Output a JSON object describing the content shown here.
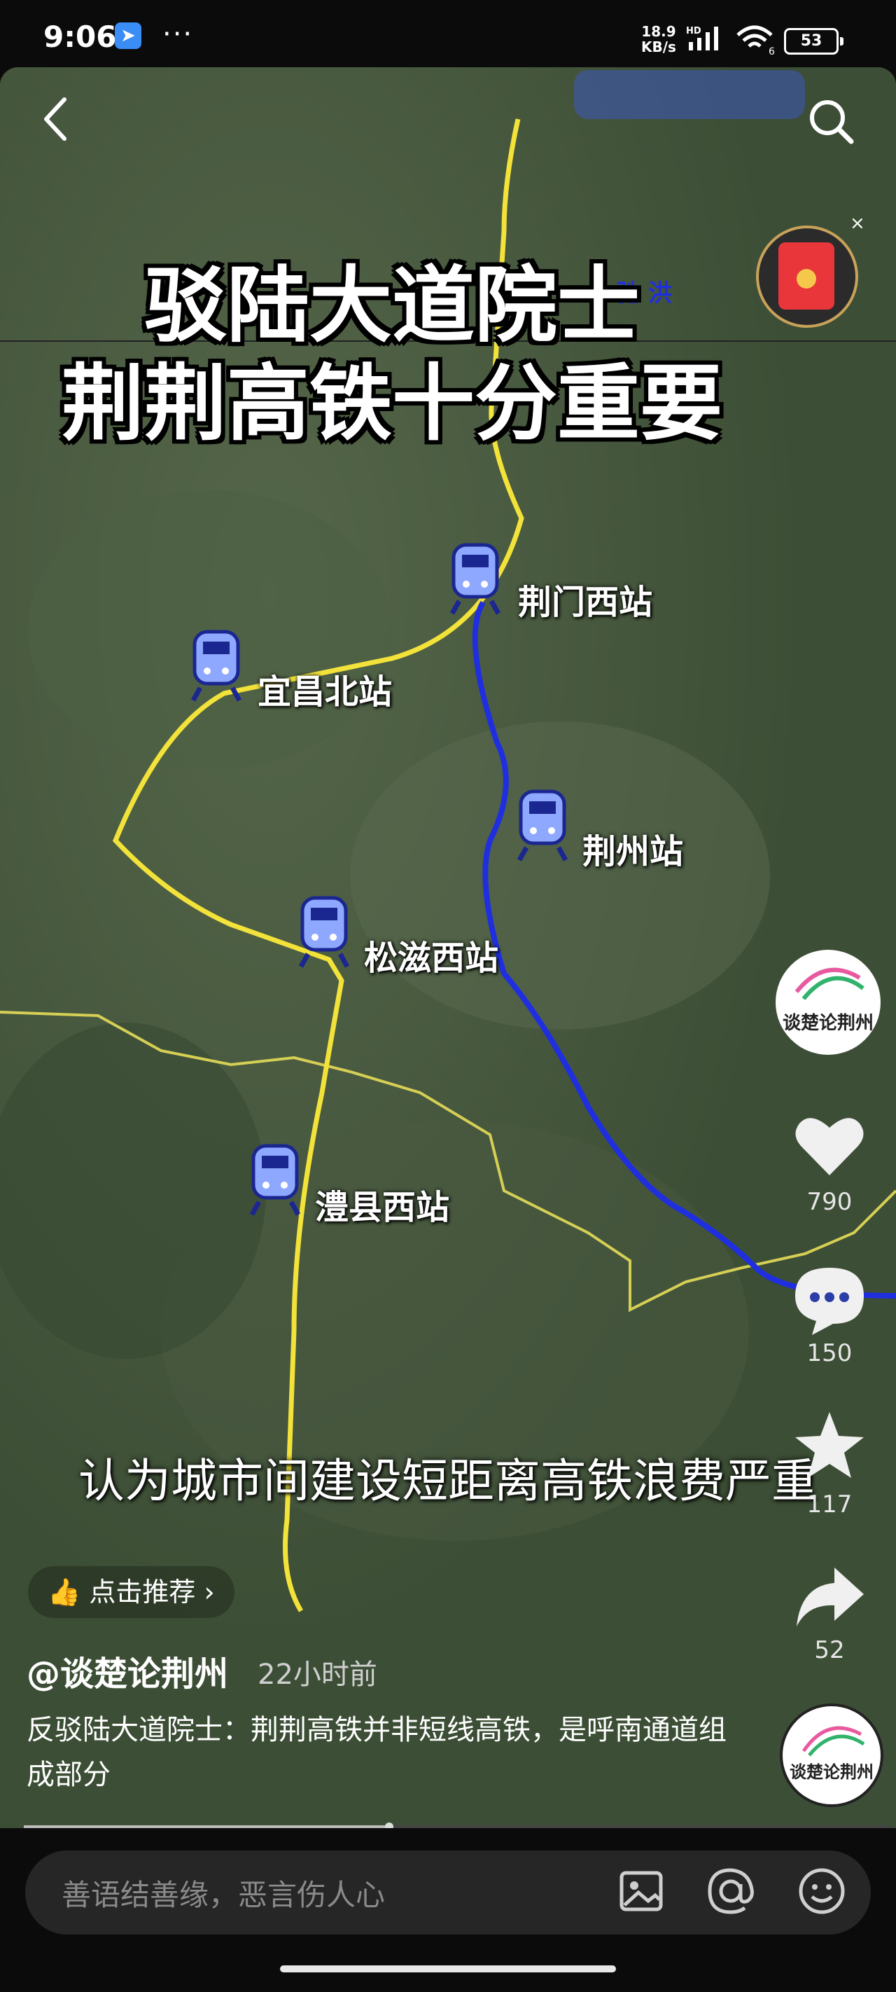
{
  "status_bar": {
    "time": "9:06",
    "net_speed_value": "18.9",
    "net_speed_unit": "KB/s",
    "signal_label": "HD",
    "wifi_label": "6",
    "battery": "53"
  },
  "video": {
    "title_line1": "驳陆大道院士",
    "title_line2": "荆荆高铁十分重要",
    "overlay_small_text": "驰 洪",
    "stations": [
      "荆门西站",
      "宜昌北站",
      "荆州站",
      "松滋西站",
      "澧县西站"
    ],
    "subtitle": "认为城市间建设短距离高铁浪费严重",
    "route_colors": {
      "yellow": "#f2e23a",
      "blue": "#1f2fe0",
      "border": "#d6cf55"
    }
  },
  "rail": {
    "avatar_text": "谈楚论荆州",
    "likes": "790",
    "comments": "150",
    "favorites": "117",
    "shares": "52"
  },
  "post": {
    "recommend_label": "点击推荐",
    "author": "@谈楚论荆州",
    "time_ago": "22小时前",
    "description": "反驳陆大道院士：荆荆高铁并非短线高铁，是呼南通道组成部分",
    "music_avatar_text": "谈楚论荆州"
  },
  "comment_bar": {
    "placeholder": "善语结善缘，恶言伤人心"
  }
}
